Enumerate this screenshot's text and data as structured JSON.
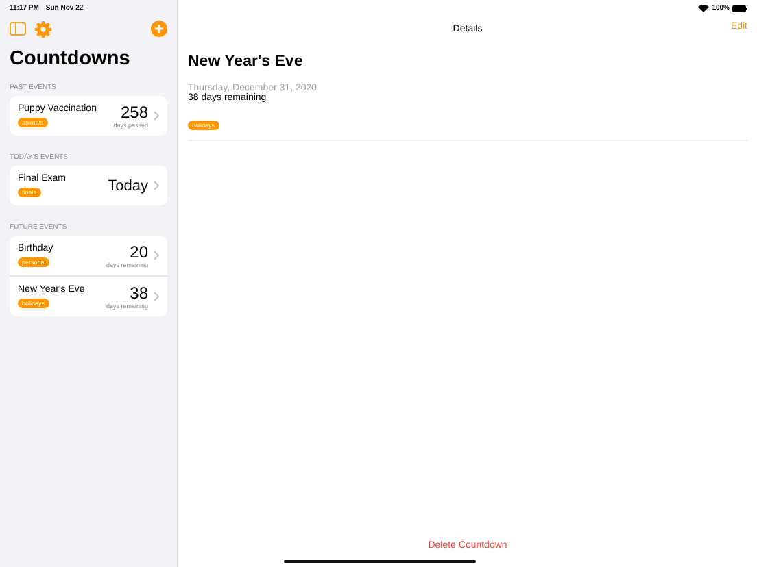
{
  "status_bar": {
    "time": "11:17 PM",
    "date": "Sun Nov 22",
    "battery": "100%"
  },
  "sidebar": {
    "title": "Countdowns",
    "sections": [
      {
        "header": "PAST EVENTS",
        "events": [
          {
            "kind": "count",
            "title": "Puppy Vaccination",
            "tag": "animals",
            "value": "258",
            "caption": "days passed"
          }
        ]
      },
      {
        "header": "TODAY'S EVENTS",
        "events": [
          {
            "kind": "today",
            "title": "Final Exam",
            "tag": "finals",
            "value": "Today"
          }
        ]
      },
      {
        "header": "FUTURE EVENTS",
        "events": [
          {
            "kind": "count",
            "title": "Birthday",
            "tag": "personal",
            "value": "20",
            "caption": "days remaining"
          },
          {
            "kind": "count",
            "title": "New Year's Eve",
            "tag": "holidays",
            "value": "38",
            "caption": "days remaining"
          }
        ]
      }
    ]
  },
  "detail": {
    "nav_title": "Details",
    "edit": "Edit",
    "title": "New Year's Eve",
    "date": "Thursday, December 31, 2020",
    "remaining": "38 days remaining",
    "tag": "holidays",
    "delete": "Delete Countdown"
  }
}
